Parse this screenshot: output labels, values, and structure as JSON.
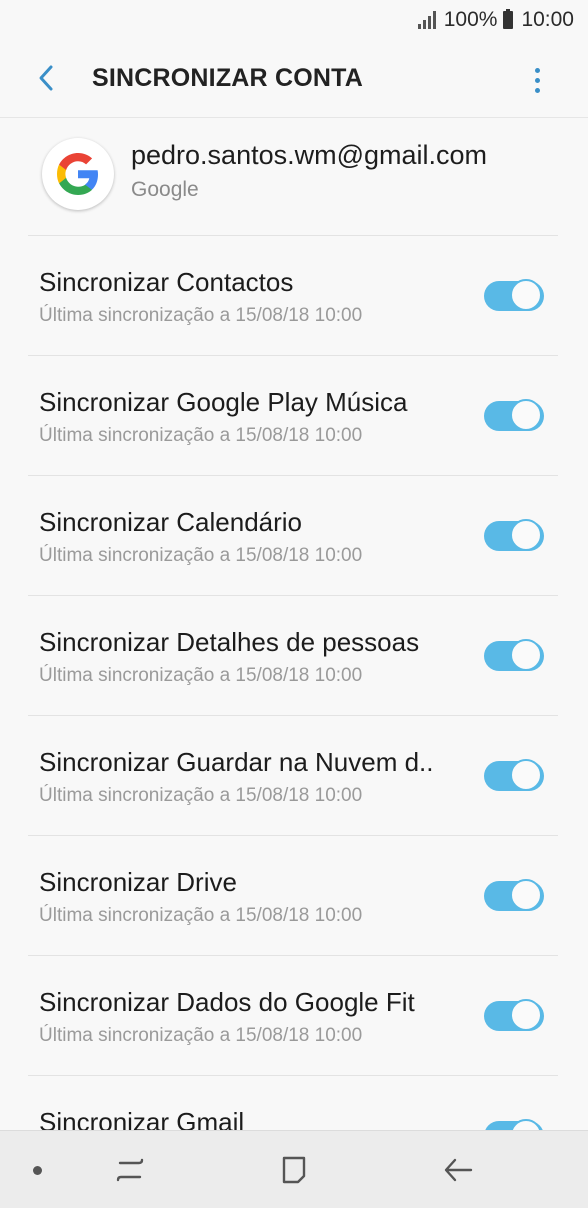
{
  "status_bar": {
    "battery": "100%",
    "time": "10:00"
  },
  "app_bar": {
    "title": "SINCRONIZAR CONTA"
  },
  "account": {
    "email": "pedro.santos.wm@gmail.com",
    "provider": "Google"
  },
  "sync_items": [
    {
      "title": "Sincronizar Contactos",
      "subtitle": "Última sincronização a 15/08/18  10:00",
      "enabled": true
    },
    {
      "title": "Sincronizar Google Play Música",
      "subtitle": "Última sincronização a 15/08/18  10:00",
      "enabled": true
    },
    {
      "title": "Sincronizar Calendário",
      "subtitle": "Última sincronização a 15/08/18  10:00",
      "enabled": true
    },
    {
      "title": "Sincronizar Detalhes de pessoas",
      "subtitle": "Última sincronização a 15/08/18  10:00",
      "enabled": true
    },
    {
      "title": "Sincronizar Guardar na Nuvem d..",
      "subtitle": "Última sincronização a 15/08/18  10:00",
      "enabled": true
    },
    {
      "title": "Sincronizar Drive",
      "subtitle": "Última sincronização a 15/08/18  10:00",
      "enabled": true
    },
    {
      "title": "Sincronizar Dados do Google Fit",
      "subtitle": "Última sincronização a 15/08/18  10:00",
      "enabled": true
    },
    {
      "title": "Sincronizar Gmail",
      "subtitle": "",
      "enabled": true
    }
  ],
  "colors": {
    "toggle_on": "#59b9e6",
    "accent": "#3a8fc8",
    "background": "#f8f8f8"
  },
  "icons": {
    "back": "back-arrow-icon",
    "more": "more-options-icon",
    "avatar": "google-logo-icon",
    "nav_dot": "nav-dot-icon",
    "recents": "recent-apps-icon",
    "home": "home-icon",
    "back_nav": "back-nav-icon"
  }
}
